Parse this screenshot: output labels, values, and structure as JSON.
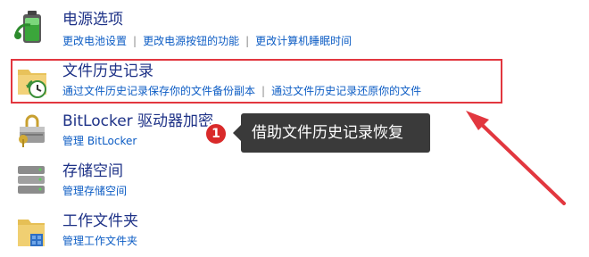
{
  "items": [
    {
      "icon": "power-battery-icon",
      "title": "电源选项",
      "links": [
        "更改电池设置",
        "更改电源按钮的功能",
        "更改计算机睡眠时间"
      ]
    },
    {
      "icon": "file-history-icon",
      "title": "文件历史记录",
      "links": [
        "通过文件历史记录保存你的文件备份副本",
        "通过文件历史记录还原你的文件"
      ]
    },
    {
      "icon": "bitlocker-icon",
      "title": "BitLocker 驱动器加密",
      "links": [
        "管理 BitLocker"
      ]
    },
    {
      "icon": "storage-spaces-icon",
      "title": "存储空间",
      "links": [
        "管理存储空间"
      ]
    },
    {
      "icon": "work-folders-icon",
      "title": "工作文件夹",
      "links": [
        "管理工作文件夹"
      ]
    }
  ],
  "callout": {
    "badge": "1",
    "text": "借助文件历史记录恢复",
    "accent_color": "#e2373f"
  }
}
